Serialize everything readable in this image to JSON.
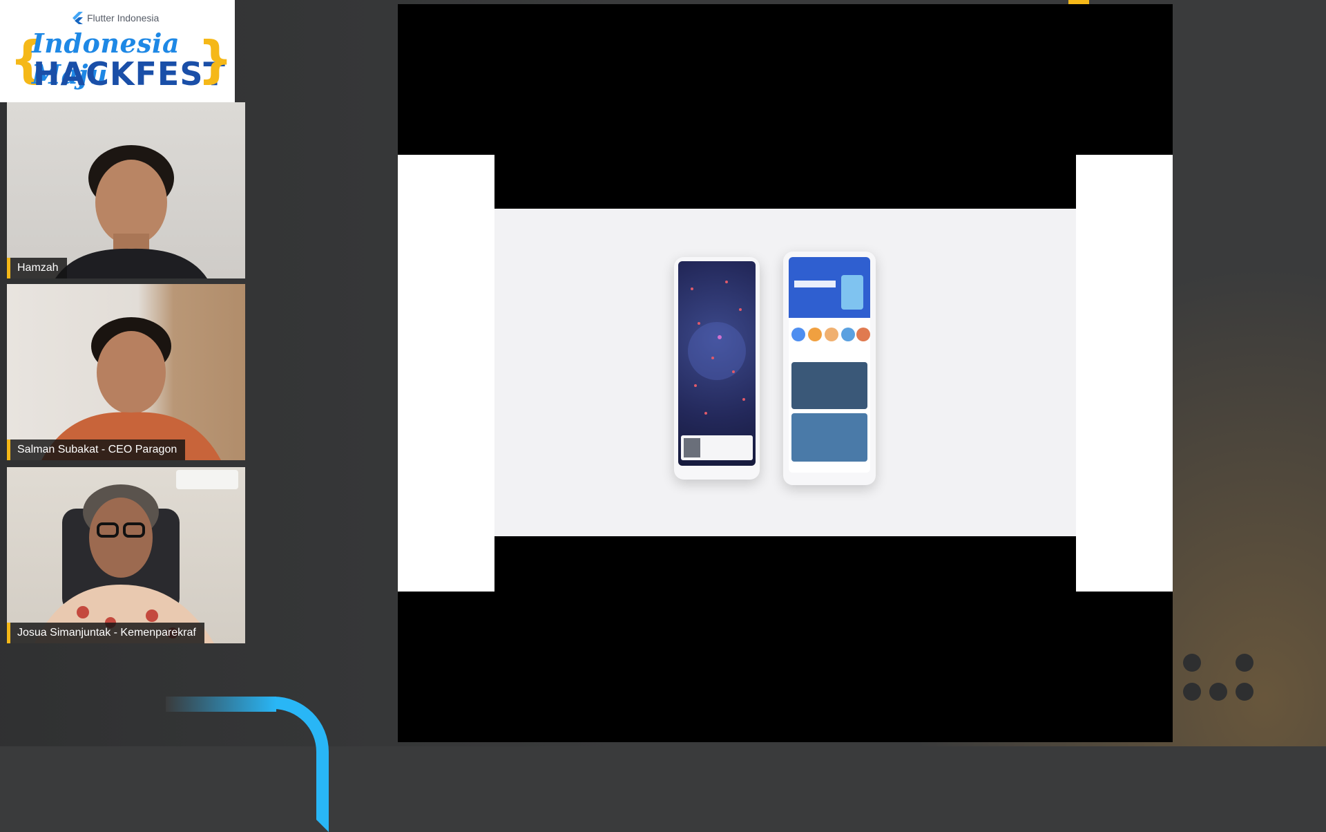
{
  "logo": {
    "org": "Flutter Indonesia",
    "script_title": "Indonesia Maju",
    "title": "HACKFEST",
    "brace_left": "{",
    "brace_right": "}"
  },
  "participants": [
    {
      "name": "Hamzah"
    },
    {
      "name": "Salman Subakat - CEO Paragon"
    },
    {
      "name": "Josua Simanjuntak - Kemenparekraf"
    }
  ],
  "colors": {
    "accent": "#f5b818",
    "brand_blue": "#1a4fa8",
    "cyan": "#29b6f6",
    "background": "#3a3b3c"
  },
  "icons": [
    "flutter-logo-icon"
  ]
}
